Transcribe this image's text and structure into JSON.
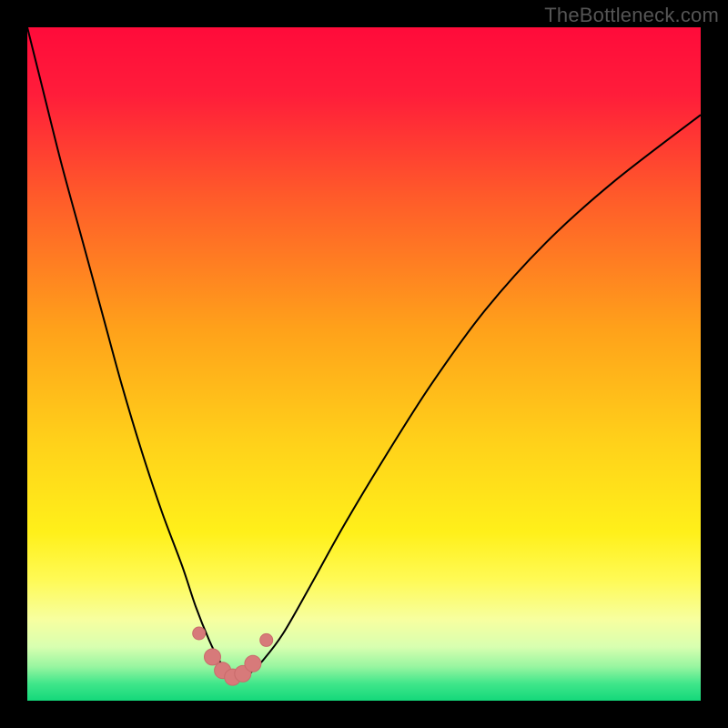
{
  "watermark": "TheBottleneck.com",
  "colors": {
    "frame": "#000000",
    "gradient_stops": [
      {
        "pos": 0.0,
        "color": "#ff0b3a"
      },
      {
        "pos": 0.1,
        "color": "#ff1d3a"
      },
      {
        "pos": 0.25,
        "color": "#ff5a2a"
      },
      {
        "pos": 0.45,
        "color": "#ffa21a"
      },
      {
        "pos": 0.62,
        "color": "#ffd21a"
      },
      {
        "pos": 0.75,
        "color": "#fff01a"
      },
      {
        "pos": 0.82,
        "color": "#fffa55"
      },
      {
        "pos": 0.88,
        "color": "#f7ffa0"
      },
      {
        "pos": 0.92,
        "color": "#d8ffb0"
      },
      {
        "pos": 0.95,
        "color": "#96f5a0"
      },
      {
        "pos": 0.975,
        "color": "#3fe68a"
      },
      {
        "pos": 1.0,
        "color": "#14d87a"
      }
    ],
    "curve": "#000000",
    "marker_fill": "#d77a7a",
    "marker_stroke": "#c96b6b"
  },
  "chart_data": {
    "type": "line",
    "title": "",
    "xlabel": "",
    "ylabel": "",
    "xlim": [
      0,
      100
    ],
    "ylim": [
      0,
      100
    ],
    "note": "V-shaped bottleneck curve. Data estimated from pixel positions; x,y are percentages of plot width/height with y=0 at bottom (green) and y=100 at top (red).",
    "series": [
      {
        "name": "bottleneck-curve",
        "x": [
          0,
          2,
          5,
          8,
          11,
          14,
          17,
          20,
          23,
          25,
          27,
          28.5,
          30,
          31.5,
          33,
          35,
          38,
          42,
          47,
          53,
          60,
          68,
          77,
          87,
          100
        ],
        "y": [
          100,
          92,
          80,
          69,
          58,
          47,
          37,
          28,
          20,
          14,
          9,
          6,
          4,
          3,
          4,
          6,
          10,
          17,
          26,
          36,
          47,
          58,
          68,
          77,
          87
        ]
      }
    ],
    "markers": {
      "name": "highlight-points",
      "x": [
        25.5,
        27.5,
        29,
        30.5,
        32,
        33.5,
        35.5
      ],
      "y": [
        10,
        6.5,
        4.5,
        3.5,
        4,
        5.5,
        9
      ]
    }
  }
}
